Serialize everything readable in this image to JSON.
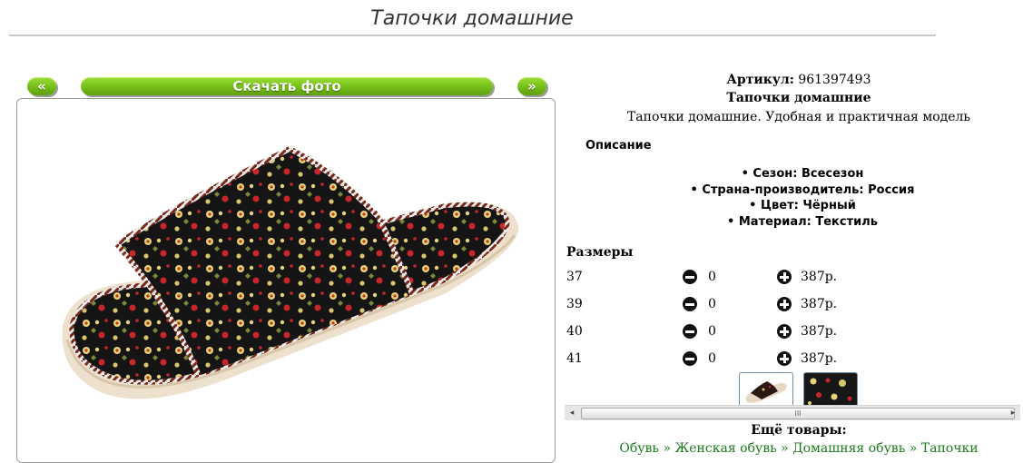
{
  "page": {
    "title": "Тапочки домашние"
  },
  "gallery": {
    "prev_label": "«",
    "next_label": "»",
    "download_label": "Скачать фото",
    "main_image": "slipper-photo"
  },
  "product": {
    "article_label": "Артикул:",
    "article_value": "961397493",
    "name": "Тапочки домашние",
    "short_description": "Тапочки домашние. Удобная и практичная модель",
    "description_heading": "Описание",
    "properties": [
      "Сезон: Всесезон",
      "Страна-производитель: Россия",
      "Цвет: Чёрный",
      "Материал: Текстиль"
    ]
  },
  "sizes": {
    "heading": "Размеры",
    "rows": [
      {
        "size": "37",
        "qty": "0",
        "price": "387р."
      },
      {
        "size": "39",
        "qty": "0",
        "price": "387р."
      },
      {
        "size": "40",
        "qty": "0",
        "price": "387р."
      },
      {
        "size": "41",
        "qty": "0",
        "price": "387р."
      }
    ]
  },
  "thumbnails": [
    "slipper-thumbnail",
    "fabric-pattern-thumbnail"
  ],
  "scrollbar": {
    "left_arrow": "◂",
    "right_arrow": "▸",
    "grip": "III"
  },
  "more": {
    "heading": "Ещё товары:",
    "links": [
      "Обувь",
      "Женская обувь",
      "Домашняя обувь",
      "Тапочки"
    ],
    "separator": "»"
  },
  "colors": {
    "accent_green": "#79c41c",
    "link_green": "#1b7a1b"
  }
}
